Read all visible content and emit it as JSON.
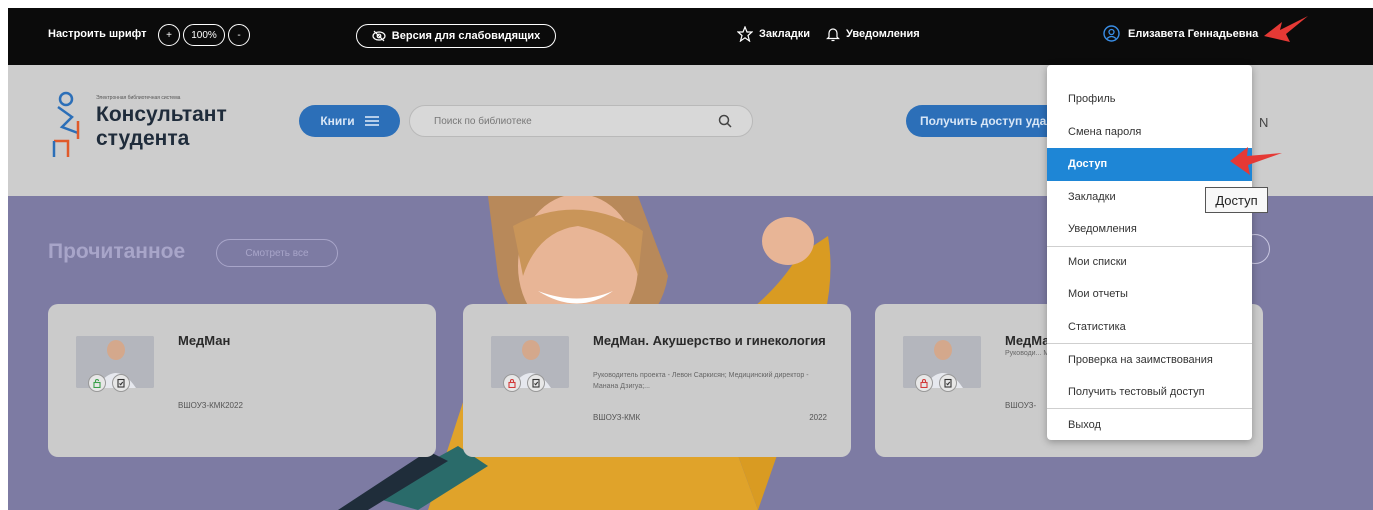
{
  "topbar": {
    "font_label": "Настроить шрифт",
    "font_plus": "+",
    "font_zoom": "100%",
    "font_minus": "-",
    "vision_label": "Версия для слабовидящих",
    "bookmarks_label": "Закладки",
    "notifications_label": "Уведомления",
    "user_name": "Елизавета Геннадьевна"
  },
  "header": {
    "logo_tagline": "Электронная библиотечная система",
    "logo_line1": "Консультант",
    "logo_line2": "студента",
    "books_label": "Книги",
    "search_placeholder": "Поиск по библиотеке",
    "access_label": "Получить доступ удаленно",
    "partial_letter": "N"
  },
  "hero": {
    "title": "Прочитанное",
    "see_all": "Смотреть все"
  },
  "cards": [
    {
      "title": "МедМан",
      "desc": "",
      "code": "ВШОУЗ-КМК2022",
      "year": ""
    },
    {
      "title": "МедМан. Акушерство и гинекология",
      "desc": "Руководитель проекта - Левон Саркисян; Медицинский директор - Манана Дзигуа;...",
      "code": "ВШОУЗ-КМК",
      "year": "2022"
    },
    {
      "title": "МедМан",
      "desc": "Руководи... Медицин...",
      "code": "ВШОУЗ-",
      "year": ""
    }
  ],
  "menu": {
    "items": [
      "Профиль",
      "Смена пароля",
      "Доступ",
      "Закладки",
      "Уведомления",
      "Мои списки",
      "Мои отчеты",
      "Статистика",
      "Проверка на заимствования",
      "Получить тестовый доступ",
      "Выход"
    ],
    "active_index": 2
  },
  "tooltip": "Доступ",
  "colors": {
    "accent": "#1e86d6",
    "topbar": "#0b0b0b",
    "hero": "#7d7ba3",
    "arrow": "#e53935"
  }
}
